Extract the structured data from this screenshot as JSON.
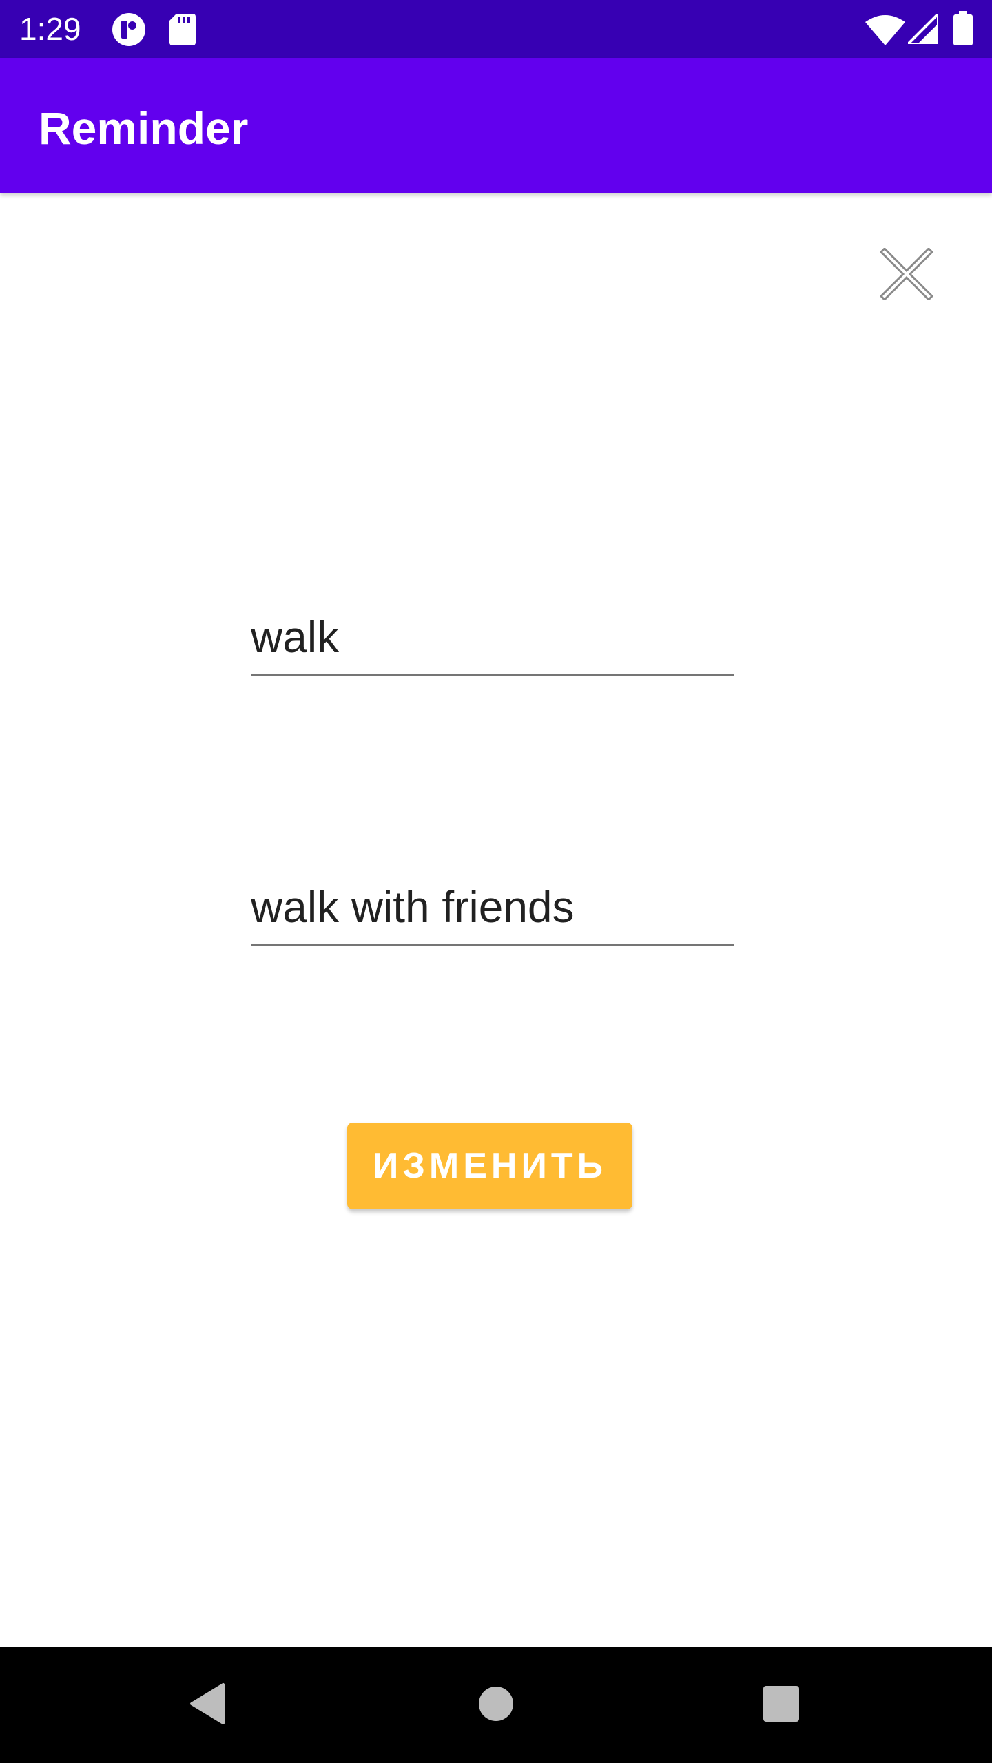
{
  "status_bar": {
    "time": "1:29",
    "icons": [
      "app-notification-icon",
      "sd-card-icon",
      "wifi-icon",
      "signal-icon",
      "battery-icon"
    ],
    "background": "#3700b3"
  },
  "app_bar": {
    "title": "Reminder",
    "background": "#6200ee"
  },
  "form": {
    "close_icon": "close-icon",
    "title_value": "walk",
    "description_value": "walk with friends",
    "submit_label": "ИЗМЕНИТЬ",
    "submit_color": "#ffbb33"
  },
  "nav_bar": {
    "buttons": [
      "back-icon",
      "home-icon",
      "recents-icon"
    ]
  }
}
